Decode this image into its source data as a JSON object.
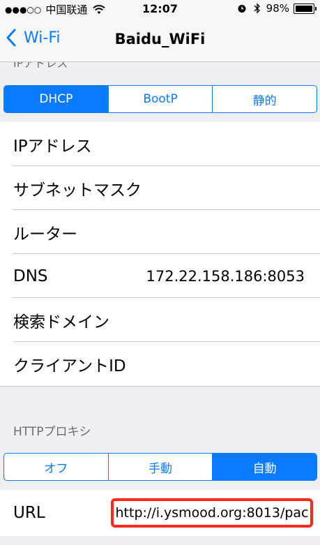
{
  "status_bar": {
    "signal_dots": "●●●○○",
    "carrier": "中国联通",
    "time": "12:07",
    "battery": "98%"
  },
  "nav": {
    "back_label": "Wi-Fi",
    "title": "Baidu_WiFi"
  },
  "ip_section": {
    "header": "IPアドレス",
    "segments": [
      "DHCP",
      "BootP",
      "静的"
    ],
    "selected": "DHCP",
    "rows": [
      {
        "label": "IPアドレス",
        "value": ""
      },
      {
        "label": "サブネットマスク",
        "value": ""
      },
      {
        "label": "ルーター",
        "value": ""
      },
      {
        "label": "DNS",
        "value": "172.22.158.186:8053"
      },
      {
        "label": "検索ドメイン",
        "value": ""
      },
      {
        "label": "クライアントID",
        "value": ""
      }
    ]
  },
  "proxy_section": {
    "header": "HTTPプロキシ",
    "segments": [
      "オフ",
      "手動",
      "自動"
    ],
    "selected": "自動",
    "url_label": "URL",
    "url_value": "http://i.ysmood.org:8013/pac"
  },
  "colors": {
    "accent": "#0a7aff",
    "highlight": "#ff2a1a",
    "background": "#efeff4"
  }
}
